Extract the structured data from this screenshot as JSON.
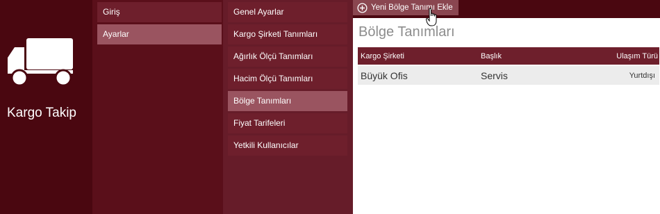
{
  "app": {
    "title": "Kargo Takip",
    "logo_icon": "truck-icon"
  },
  "colors": {
    "dark": "#4a0710",
    "menu": "#5a0f1a",
    "submenu": "#661c29",
    "item": "#6e1f2c",
    "active": "#9a5460"
  },
  "menu": {
    "items": [
      {
        "label": "Giriş"
      },
      {
        "label": "Ayarlar",
        "active": true
      }
    ]
  },
  "submenu": {
    "items": [
      {
        "label": "Genel Ayarlar"
      },
      {
        "label": "Kargo Şirketi Tanımları"
      },
      {
        "label": "Ağırlık Ölçü Tanımları"
      },
      {
        "label": "Hacim Ölçü Tanımları"
      },
      {
        "label": "Bölge Tanımları",
        "active": true
      },
      {
        "label": "Fiyat Tarifeleri"
      },
      {
        "label": "Yetkili Kullanıcılar"
      }
    ]
  },
  "main": {
    "add_button_label": "Yeni Bölge Tanımı Ekle",
    "add_button_icon": "plus-circle-icon",
    "title": "Bölge Tanımları",
    "table": {
      "headers": [
        "Kargo Şirketi",
        "Başlık",
        "Ulaşım Türü"
      ],
      "rows": [
        [
          "Büyük Ofis",
          "Servis",
          "Yurtdışı"
        ]
      ]
    }
  }
}
